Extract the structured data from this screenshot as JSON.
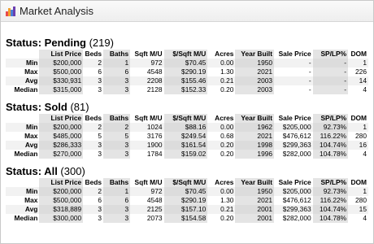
{
  "title": "Market Analysis",
  "columns": [
    "",
    "List Price",
    "Beds",
    "Baths",
    "Sqft M/U",
    "$/Sqft M/U",
    "Acres",
    "Year Built",
    "Sale Price",
    "SP/LP%",
    "DOM"
  ],
  "sections": [
    {
      "label": "Status: Pending",
      "count": "(219)",
      "rows": [
        {
          "name": "Min",
          "values": [
            "$200,000",
            "2",
            "1",
            "972",
            "$70.45",
            "0.00",
            "1950",
            "-",
            "-",
            "1"
          ]
        },
        {
          "name": "Max",
          "values": [
            "$500,000",
            "6",
            "6",
            "4548",
            "$290.19",
            "1.30",
            "2021",
            "-",
            "-",
            "226"
          ]
        },
        {
          "name": "Avg",
          "values": [
            "$330,931",
            "3",
            "3",
            "2208",
            "$155.46",
            "0.21",
            "2003",
            "-",
            "-",
            "14"
          ]
        },
        {
          "name": "Median",
          "values": [
            "$315,000",
            "3",
            "3",
            "2128",
            "$152.33",
            "0.20",
            "2003",
            "-",
            "-",
            "4"
          ]
        }
      ]
    },
    {
      "label": "Status: Sold",
      "count": "(81)",
      "rows": [
        {
          "name": "Min",
          "values": [
            "$200,000",
            "2",
            "2",
            "1024",
            "$88.16",
            "0.00",
            "1962",
            "$205,000",
            "92.73%",
            "1"
          ]
        },
        {
          "name": "Max",
          "values": [
            "$485,000",
            "5",
            "5",
            "3176",
            "$249.54",
            "0.68",
            "2021",
            "$476,612",
            "116.22%",
            "280"
          ]
        },
        {
          "name": "Avg",
          "values": [
            "$286,333",
            "3",
            "3",
            "1900",
            "$161.54",
            "0.20",
            "1998",
            "$299,363",
            "104.74%",
            "16"
          ]
        },
        {
          "name": "Median",
          "values": [
            "$270,000",
            "3",
            "3",
            "1784",
            "$159.02",
            "0.20",
            "1996",
            "$282,000",
            "104.78%",
            "4"
          ]
        }
      ]
    },
    {
      "label": "Status: All",
      "count": "(300)",
      "rows": [
        {
          "name": "Min",
          "values": [
            "$200,000",
            "2",
            "1",
            "972",
            "$70.45",
            "0.00",
            "1950",
            "$205,000",
            "92.73%",
            "1"
          ]
        },
        {
          "name": "Max",
          "values": [
            "$500,000",
            "6",
            "6",
            "4548",
            "$290.19",
            "1.30",
            "2021",
            "$476,612",
            "116.22%",
            "280"
          ]
        },
        {
          "name": "Avg",
          "values": [
            "$318,889",
            "3",
            "3",
            "2125",
            "$157.10",
            "0.21",
            "2001",
            "$299,363",
            "104.74%",
            "15"
          ]
        },
        {
          "name": "Median",
          "values": [
            "$300,000",
            "3",
            "3",
            "2073",
            "$154.58",
            "0.20",
            "2001",
            "$282,000",
            "104.78%",
            "4"
          ]
        }
      ]
    }
  ],
  "icon_colors": [
    "#e94b4b",
    "#f0a030",
    "#4a7fd6",
    "#6a3fb0"
  ]
}
